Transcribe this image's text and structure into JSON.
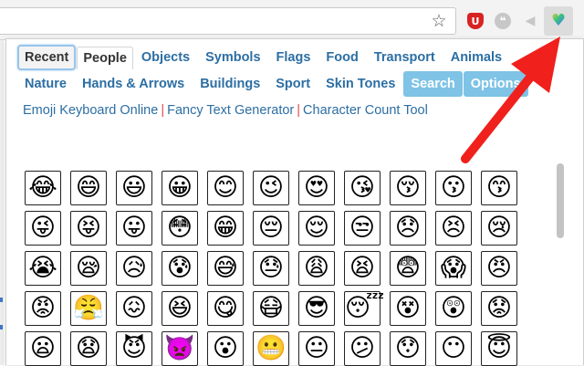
{
  "toolbar": {
    "star_glyph": "☆",
    "ext_red_glyph": "U",
    "ext_quote_glyph": "❝",
    "ext_speaker_glyph": "◀",
    "ext_emoji_glyph": "♥"
  },
  "tabs_row1": [
    {
      "name": "tab-recent",
      "label": "Recent",
      "cls": "selected"
    },
    {
      "name": "tab-people",
      "label": "People",
      "cls": "people"
    },
    {
      "name": "tab-objects",
      "label": "Objects",
      "cls": ""
    },
    {
      "name": "tab-symbols",
      "label": "Symbols",
      "cls": ""
    },
    {
      "name": "tab-flags",
      "label": "Flags",
      "cls": ""
    },
    {
      "name": "tab-food",
      "label": "Food",
      "cls": ""
    },
    {
      "name": "tab-transport",
      "label": "Transport",
      "cls": ""
    },
    {
      "name": "tab-animals",
      "label": "Animals",
      "cls": ""
    }
  ],
  "tabs_row2": [
    {
      "name": "tab-nature",
      "label": "Nature",
      "cls": ""
    },
    {
      "name": "tab-hands-arrows",
      "label": "Hands & Arrows",
      "cls": ""
    },
    {
      "name": "tab-buildings",
      "label": "Buildings",
      "cls": ""
    },
    {
      "name": "tab-sport",
      "label": "Sport",
      "cls": ""
    },
    {
      "name": "tab-skin-tones",
      "label": "Skin Tones",
      "cls": ""
    },
    {
      "name": "search-button",
      "label": "Search",
      "cls": "btn"
    },
    {
      "name": "options-button",
      "label": "Options",
      "cls": "btn"
    }
  ],
  "links": [
    "Emoji Keyboard Online",
    "Fancy Text Generator",
    "Character Count Tool"
  ],
  "link_separator": "|",
  "emoji_rows": [
    [
      "😂",
      "😄",
      "😃",
      "😀",
      "😊",
      "😉",
      "😍",
      "😘",
      "😚",
      "😗",
      "😙"
    ],
    [
      "😜",
      "😝",
      "😛",
      "😳",
      "😁",
      "😔",
      "😌",
      "😒",
      "😞",
      "😣",
      "😢"
    ],
    [
      "😭",
      "😪",
      "😥",
      "😰",
      "😅",
      "😓",
      "😩",
      "😫",
      "😨",
      "😱",
      "😠"
    ],
    [
      "😡",
      "😤",
      "😖",
      "😆",
      "😋",
      "😷",
      "😎",
      "😴",
      "😵",
      "😲",
      "😟"
    ],
    [
      "😦",
      "😧",
      "😈",
      "👿",
      "😮",
      "😬",
      "😐",
      "😕",
      "😯",
      "😶",
      "😇"
    ]
  ],
  "colors": {
    "tab_text": "#2c6ea3",
    "button_bg": "#7fc3e6",
    "link_separator": "#e04c4c",
    "arrow": "#f0201c"
  }
}
